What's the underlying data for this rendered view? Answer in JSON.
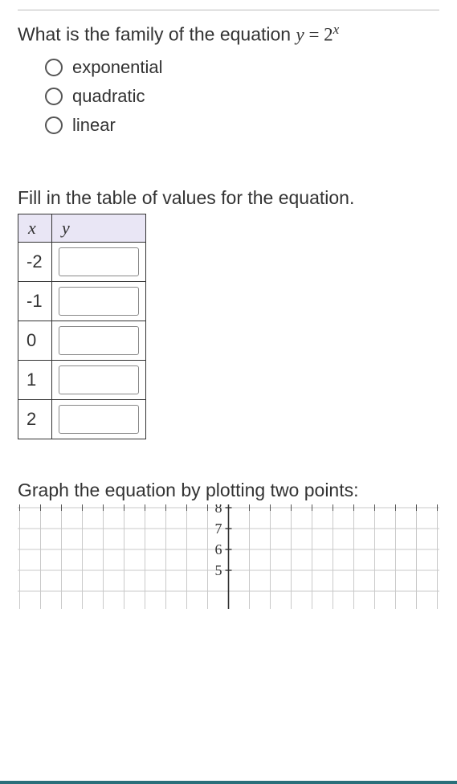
{
  "question": {
    "prefix": "What is the family of the equation ",
    "lhs": "y",
    "eq": " = ",
    "base": "2",
    "exp": "x"
  },
  "options": [
    {
      "label": "exponential"
    },
    {
      "label": "quadratic"
    },
    {
      "label": "linear"
    }
  ],
  "table_prompt": "Fill in the table of values for the equation.",
  "table": {
    "x_header": "x",
    "y_header": "y",
    "rows": [
      {
        "x": "-2",
        "y": ""
      },
      {
        "x": "-1",
        "y": ""
      },
      {
        "x": "0",
        "y": ""
      },
      {
        "x": "1",
        "y": ""
      },
      {
        "x": "2",
        "y": ""
      }
    ]
  },
  "graph_prompt": "Graph the equation by plotting two points:",
  "chart_data": {
    "type": "line",
    "title": "",
    "xlabel": "",
    "ylabel": "",
    "xlim": [
      -10,
      10
    ],
    "ylim": [
      4,
      8
    ],
    "y_tick_labels": [
      8,
      7,
      6,
      5
    ],
    "grid": true,
    "series": []
  }
}
